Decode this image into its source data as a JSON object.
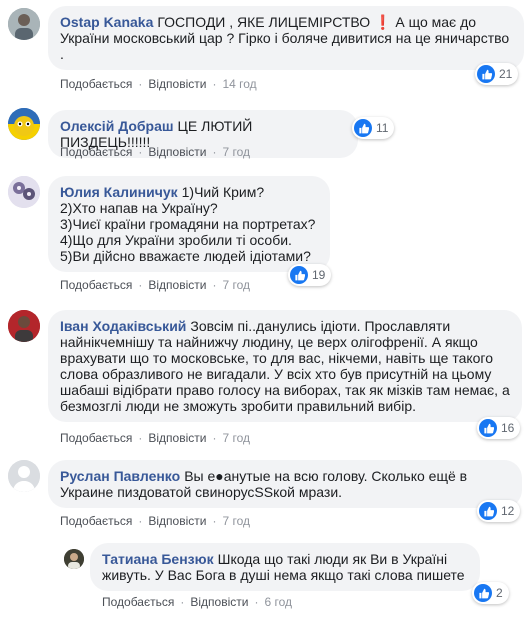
{
  "comments": [
    {
      "author": "Ostap Kanaka",
      "text": "ГОСПОДИ , ЯКЕ ЛИЦЕМІРСТВО ❗ А що має до України московський цар ? Гірко і боляче дивитися на це яничарство .",
      "like_label": "Подобається",
      "reply_label": "Відповісти",
      "time": "14 год",
      "reactions": "21",
      "avatar_icon": "man-photo-avatar"
    },
    {
      "author": "Олексій Добраш",
      "text": "ЦЕ ЛЮТИЙ ПИЗДЕЦЬ!!!!!!",
      "like_label": "Подобається",
      "reply_label": "Відповісти",
      "time": "7 год",
      "reactions": "11",
      "avatar_icon": "yellow-blue-face-avatar"
    },
    {
      "author": "Юлия Калиничук",
      "text": "1)Чий Крим?\n2)Хто напав на Україну?\n3)Чиєї країни громадяни на портретах?\n4)Що для України зробили ті особи.\n5)Ви дійсно вважаєте людей ідіотами?",
      "like_label": "Подобається",
      "reply_label": "Відповісти",
      "time": "7 год",
      "reactions": "19",
      "avatar_icon": "flowers-avatar"
    },
    {
      "author": "Іван Ходаківський",
      "text": "Зовсім пі..данулись ідіоти. Прославляти найнікчемнішу та найнижчу людину, це верх олігофренії. А якщо врахувати що то московське, то для вас, нікчеми, навіть ще такого слова образливого не вигадали. У всіх хто був присутній на цьому шабаші відібрати право голосу на виборах, так як мізків там немає, а безмозглі люди не зможуть зробити правильний вибір.",
      "like_label": "Подобається",
      "reply_label": "Відповісти",
      "time": "7 год",
      "reactions": "16",
      "avatar_icon": "man-red-background-avatar"
    },
    {
      "author": "Руслан Павленко",
      "text": "Вы е●анутые на всю голову. Сколько ещё в Украине пиздоватой свинорусSSкой мрази.",
      "like_label": "Подобається",
      "reply_label": "Відповісти",
      "time": "7 год",
      "reactions": "12",
      "avatar_icon": "default-user-avatar"
    }
  ],
  "reply": {
    "author": "Татиана Бензюк",
    "text": "Шкода що такі люди як Ви в Україні живуть. У Вас Бога в душі нема якщо такі слова пишете",
    "like_label": "Подобається",
    "reply_label": "Відповісти",
    "time": "6 год",
    "reactions": "2",
    "avatar_icon": "woman-photo-avatar"
  },
  "colors": {
    "author": "#385898",
    "bubble": "#f2f3f5",
    "like_blue": "#1877f2",
    "meta": "#90949c"
  }
}
